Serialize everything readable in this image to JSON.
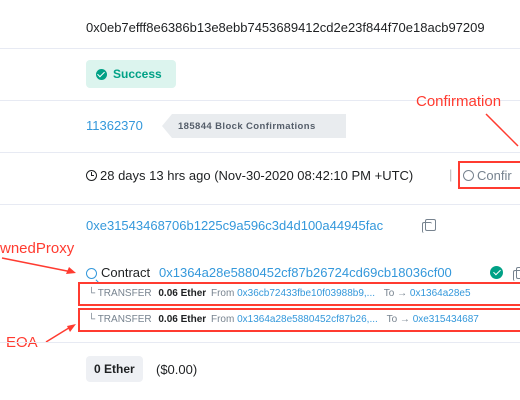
{
  "tx": {
    "hash": "0x0eb7efff8e6386b13e8ebb7453689412cd2e23f844f70e18acb97209",
    "status": "Success",
    "block_number": "11362370",
    "block_confirmations": "185844 Block Confirmations",
    "timestamp": "28 days 13 hrs ago (Nov-30-2020 08:42:10 PM +UTC)",
    "timestamp_separator": "|",
    "confirmed_partial": "Confir",
    "from_address": "0xe31543468706b1225c9a596c3d4d100a44945fac",
    "to_label": "Contract",
    "to_address": "0x1364a28e5880452cf87b26724cd69cb18036cf00",
    "value": "0 Ether",
    "value_usd": "($0.00)"
  },
  "transfers": [
    {
      "prefix": "TRANSFER",
      "amount": "0.06 Ether",
      "from_label": "From",
      "from_address": "0x36cb72433fbe10f03988b9,...",
      "to_label": "To",
      "to_address": "0x1364a28e5"
    },
    {
      "prefix": "TRANSFER",
      "amount": "0.06 Ether",
      "from_label": "From",
      "from_address": "0x1364a28e5880452cf87b26,...",
      "to_label": "To",
      "to_address": "0xe315434687"
    }
  ],
  "annotations": {
    "confirmation": "Confirmation",
    "proxy": "wnedProxy",
    "eoa": "EOA"
  },
  "icons": {
    "success": "check-circle-icon",
    "clock": "clock-icon",
    "copy": "copy-icon",
    "contract": "contract-search-icon",
    "verified": "verified-check-icon"
  },
  "colors": {
    "link": "#3498db",
    "success": "#00a186",
    "annotation": "#ff3b30"
  }
}
